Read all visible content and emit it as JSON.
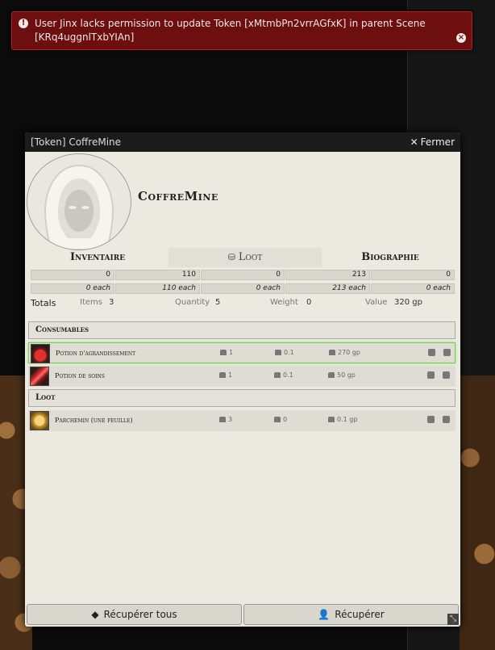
{
  "notification": {
    "message": "User Jinx lacks permission to update Token [xMtmbPn2vrrAGfxK] in parent Scene [KRq4uggnlTxbYIAn]"
  },
  "sheet": {
    "title": "[Token] CoffreMine",
    "close_label": "Fermer",
    "name": "CoffreMine",
    "tabs": [
      "Inventaire",
      "Loot",
      "Biographie"
    ],
    "currency_totals": [
      "0",
      "110",
      "0",
      "213",
      "0"
    ],
    "currency_each": [
      "0 each",
      "110 each",
      "0 each",
      "213 each",
      "0 each"
    ],
    "totals": {
      "label": "Totals",
      "items_label": "Items",
      "items": "3",
      "quantity_label": "Quantity",
      "quantity": "5",
      "weight_label": "Weight",
      "weight": "0",
      "value_label": "Value",
      "value": "320 gp"
    },
    "categories": [
      {
        "name": "Consumables",
        "items": [
          {
            "name": "Potion d'agrandissement",
            "qty": "1",
            "weight": "0.1",
            "price": "270 gp",
            "icon": "red-potion-icon"
          },
          {
            "name": "Potion de soins",
            "qty": "1",
            "weight": "0.1",
            "price": "50 gp",
            "icon": "healing-potion-icon"
          }
        ]
      },
      {
        "name": "Loot",
        "items": [
          {
            "name": "Parchemin (une feuille)",
            "qty": "3",
            "weight": "0",
            "price": "0.1 gp",
            "icon": "scroll-icon"
          }
        ]
      }
    ],
    "footer": {
      "take_all_label": "Récupérer tous",
      "take_label": "Récupérer"
    }
  },
  "colors": {
    "notice_bg": "#6e0f0f",
    "sheet_bg": "#ebe9e0",
    "highlight": "#75d455"
  }
}
